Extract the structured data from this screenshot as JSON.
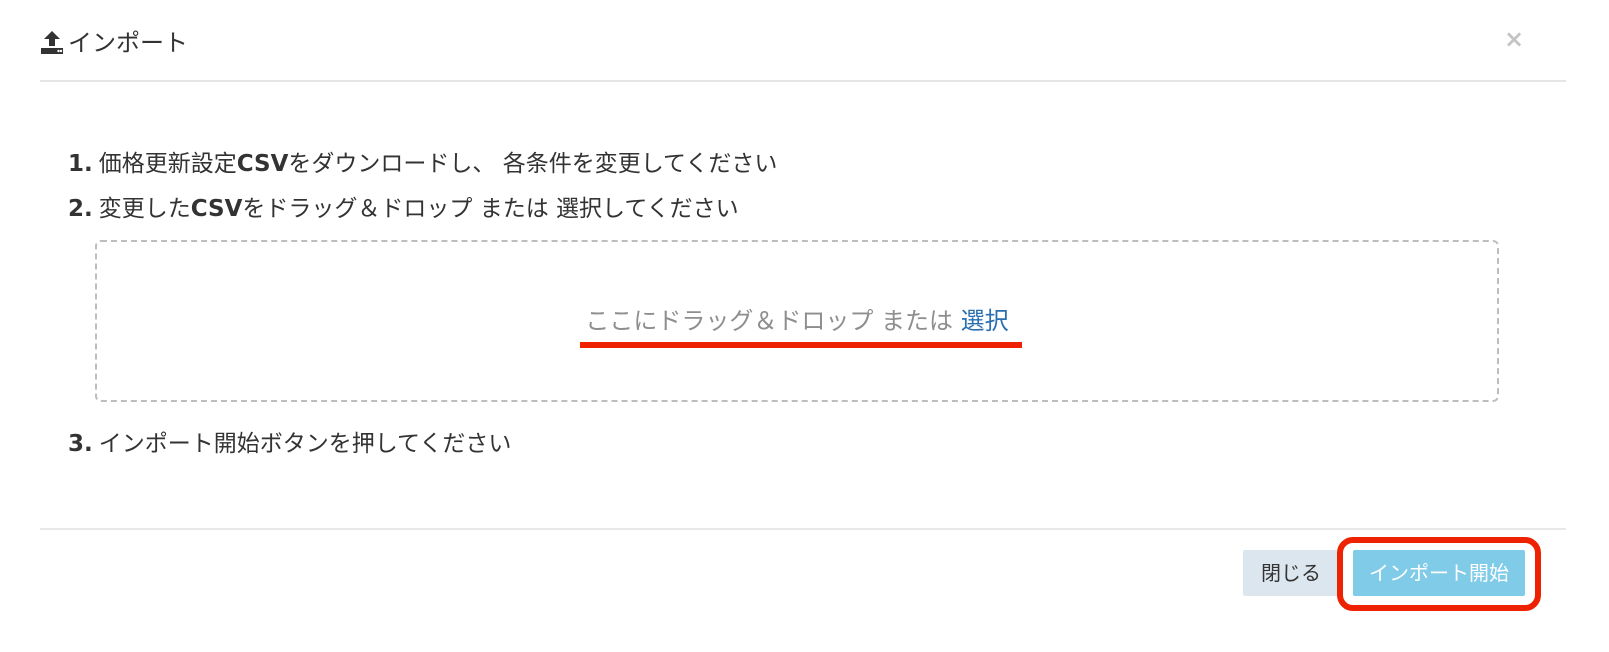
{
  "modal": {
    "title": "インポート",
    "header_icon": "upload-icon",
    "close_icon": "close-icon",
    "close_glyph": "×"
  },
  "steps": [
    {
      "number": "1.",
      "text_before": "価格更新設定",
      "text_bold": "CSV",
      "text_after": "をダウンロードし、 各条件を変更してください"
    },
    {
      "number": "2.",
      "text_before": "変更した",
      "text_bold": "CSV",
      "text_after": "をドラッグ＆ドロップ または 選択してください"
    },
    {
      "number": "3.",
      "text_before": "インポート開始ボタンを押してください",
      "text_bold": "",
      "text_after": ""
    }
  ],
  "dropzone": {
    "text": "ここにドラッグ＆ドロップ または ",
    "link": "選択"
  },
  "footer": {
    "close_label": "閉じる",
    "import_label": "インポート開始"
  },
  "colors": {
    "annotation_red": "#ee2200",
    "import_button": "#7fcbe8",
    "close_button": "#dbe6ee",
    "link_blue": "#2a6fb0"
  }
}
